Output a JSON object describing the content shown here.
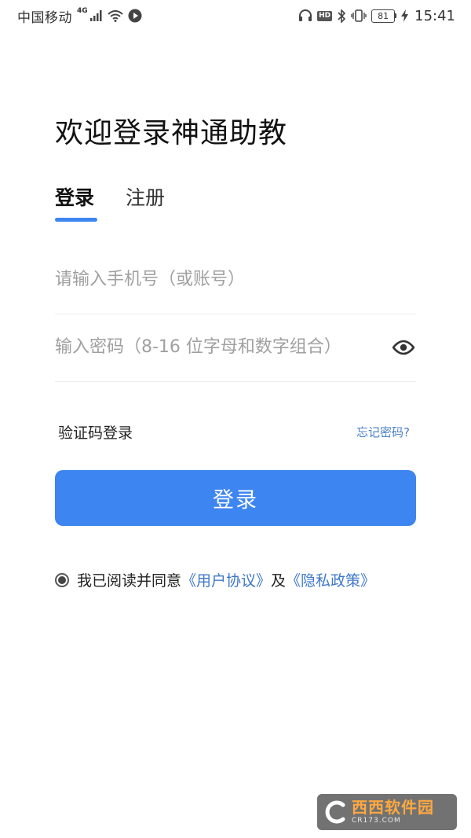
{
  "status_bar": {
    "carrier": "中国移动",
    "network": "4G",
    "battery": "81",
    "time": "15:41",
    "hd": "HD"
  },
  "page": {
    "title": "欢迎登录神通助教"
  },
  "tabs": [
    {
      "label": "登录",
      "active": true
    },
    {
      "label": "注册",
      "active": false
    }
  ],
  "form": {
    "phone_placeholder": "请输入手机号（或账号）",
    "password_placeholder": "输入密码（8-16 位字母和数字组合）",
    "sms_login": "验证码登录",
    "forgot_password": "忘记密码?",
    "login_button": "登录"
  },
  "agreement": {
    "prefix": "我已阅读并同意",
    "user_agreement": "《用户协议》",
    "joiner": "及",
    "privacy_policy": "《隐私政策》"
  },
  "watermark": {
    "brand": "西西软件园",
    "site": "CR173.COM"
  },
  "colors": {
    "accent": "#3d85f0",
    "link": "#3f78c9"
  },
  "icons": {
    "password_toggle": "eye-icon"
  }
}
